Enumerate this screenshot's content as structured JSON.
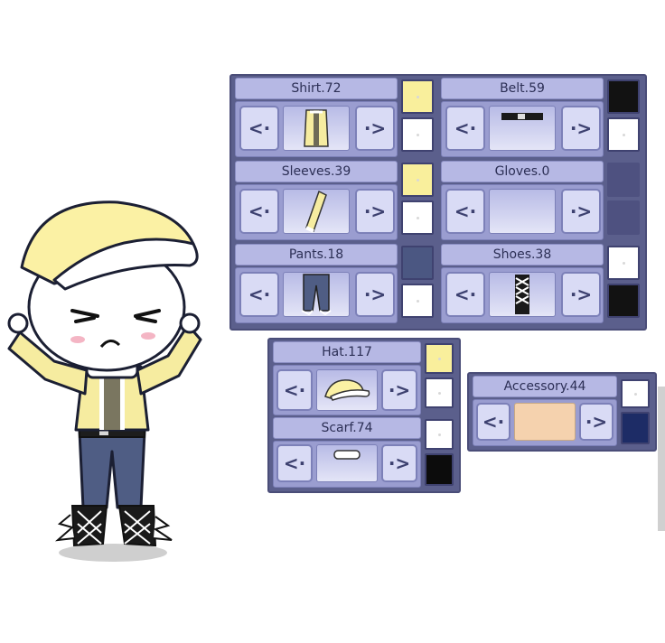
{
  "panels": {
    "main": {
      "slots": [
        {
          "label": "Shirt.72",
          "color1": "#f9ef9c",
          "color2": "#ffffff",
          "item": "shirt"
        },
        {
          "label": "Belt.59",
          "color1": "#121212",
          "color2": "#ffffff",
          "item": "belt"
        },
        {
          "label": "Sleeves.39",
          "color1": "#f9ef9c",
          "color2": "#ffffff",
          "item": "sleeve"
        },
        {
          "label": "Gloves.0",
          "color1": "#4e5180",
          "color2": "#4e5180",
          "item": "none"
        },
        {
          "label": "Pants.18",
          "color1": "#4b5782",
          "color2": "#ffffff",
          "item": "pants"
        },
        {
          "label": "Shoes.38",
          "color1": "#ffffff",
          "color2": "#121212",
          "item": "shoes"
        }
      ]
    },
    "headwear": {
      "slots": [
        {
          "label": "Hat.117",
          "color1": "#f9ef9c",
          "color2": "#ffffff",
          "item": "hat"
        },
        {
          "label": "Scarf.74",
          "color1": "#ffffff",
          "color2": "#0c0c0c",
          "item": "scarf"
        }
      ]
    },
    "accessory": {
      "slots": [
        {
          "label": "Accessory.44",
          "color1": "#ffffff",
          "color2": "#1d2c66",
          "item": "accessory"
        }
      ]
    }
  },
  "arrows": {
    "prev": "<·",
    "next": "·>"
  },
  "colors": {
    "panel": "#5b5f8c",
    "header": "#b6b8e4",
    "button": "#d9dbf5",
    "cap": "#fbf1a4",
    "jacket": "#f6eca0",
    "pants": "#4f5d84",
    "accessory_preview": "#f5d2ae"
  }
}
